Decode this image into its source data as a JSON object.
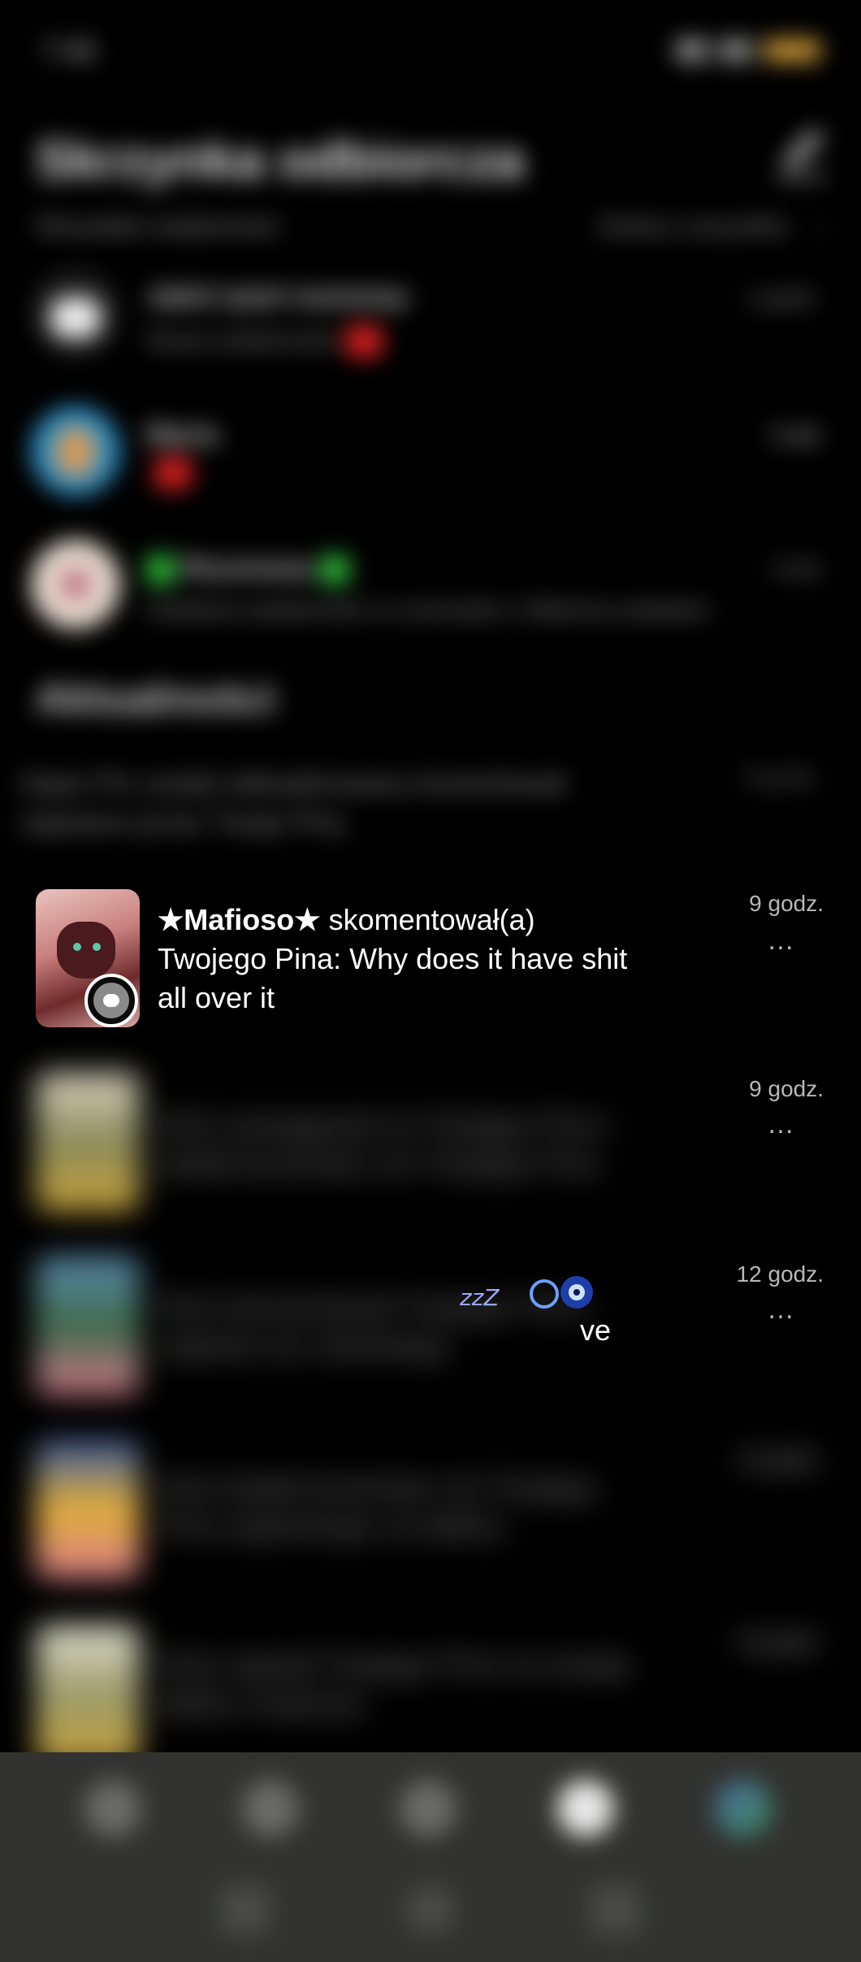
{
  "status_bar": {
    "time": "7:45"
  },
  "header": {
    "title": "Skrzynka odbiorcza",
    "filter_left": "Wszystkie wiadomości",
    "filter_right": "Zobacz wszystkie"
  },
  "messages": [
    {
      "name": "Jakiś tytuł rozmowy",
      "preview": "Nowa wiadomość",
      "time": "1 godz."
    },
    {
      "name": "Maria",
      "preview": "",
      "time": "5 dni"
    },
    {
      "name": "Rozmowa",
      "preview": "Ostatnia wiadomość w rozmowie z kilkoma osobami",
      "time": "2 dni"
    }
  ],
  "updates": {
    "title": "Aktualności",
    "first": {
      "text": "Zapis Pin został zaktualizowany komentował zapisano przez Twoje Piny",
      "time": "8 godz."
    },
    "items": [
      {
        "name": "★Mafioso★",
        "action": " skomentował(a)",
        "text": "Twojego Pina: Why does it have shit all over it",
        "time": "9 godz.",
        "more": "…"
      },
      {
        "text": "Ktoś zareagował na Twojego Pina i dodał komentarz do Twojego Pina",
        "time": "9 godz.",
        "more": "…"
      },
      {
        "text": "Ktoś skomentował Twojego Pina i napisał coś ciekawego",
        "time": "12 godz.",
        "more": "…"
      },
      {
        "text": "Ktoś dodał komentarz do Twojego Pina zapisanego na tablicy",
        "time": "13 godz.",
        "more": "…"
      },
      {
        "text": "Ktoś zapisał Twojego Pina na swojej tablicy inspiracji",
        "time": "16 godz.",
        "more": "…"
      }
    ]
  },
  "sticker": {
    "visible_tail": "ve"
  },
  "colors": {
    "background": "#000000",
    "nav": "#323330",
    "text_muted": "#8d8d8d"
  }
}
